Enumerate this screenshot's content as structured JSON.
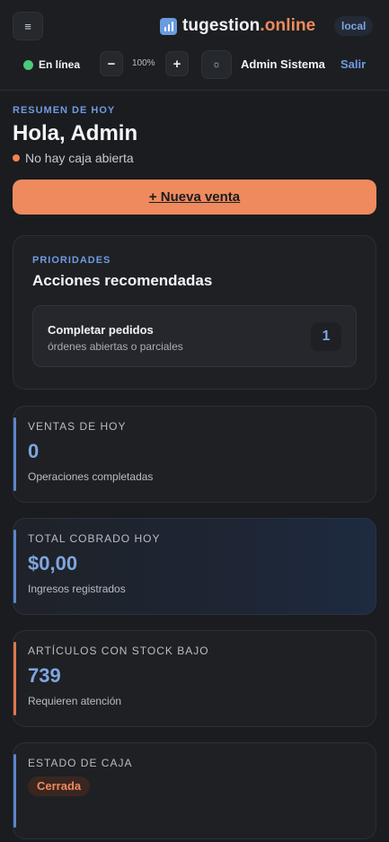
{
  "header": {
    "menu_icon": "≡",
    "brand_main": "tugestion",
    "brand_accent": ".online",
    "env_badge": "local",
    "status_label": "En línea",
    "zoom_minus": "−",
    "zoom_value": "100%",
    "zoom_plus": "+",
    "theme_icon": "☼",
    "user_name": "Admin Sistema",
    "logout_label": "Salir"
  },
  "summary": {
    "eyebrow": "RESUMEN DE HOY",
    "greeting": "Hola, Admin",
    "cash_status": "No hay caja abierta",
    "new_sale_label": "+ Nueva venta"
  },
  "priorities": {
    "eyebrow": "PRIORIDADES",
    "title": "Acciones recomendadas",
    "items": [
      {
        "title": "Completar pedidos",
        "subtitle": "órdenes abiertas o parciales",
        "count": "1"
      }
    ]
  },
  "stats": [
    {
      "label": "VENTAS DE HOY",
      "value": "0",
      "sub": "Operaciones completadas"
    },
    {
      "label": "TOTAL COBRADO HOY",
      "value": "$0,00",
      "sub": "Ingresos registrados"
    },
    {
      "label": "ARTÍCULOS CON STOCK BAJO",
      "value": "739",
      "sub": "Requieren atención"
    },
    {
      "label": "ESTADO DE CAJA",
      "badge": "Cerrada"
    }
  ],
  "colors": {
    "accent_blue": "#6f9be0",
    "accent_orange": "#ee8a5e",
    "status_green": "#4cc97a",
    "background": "#1a1c20"
  }
}
